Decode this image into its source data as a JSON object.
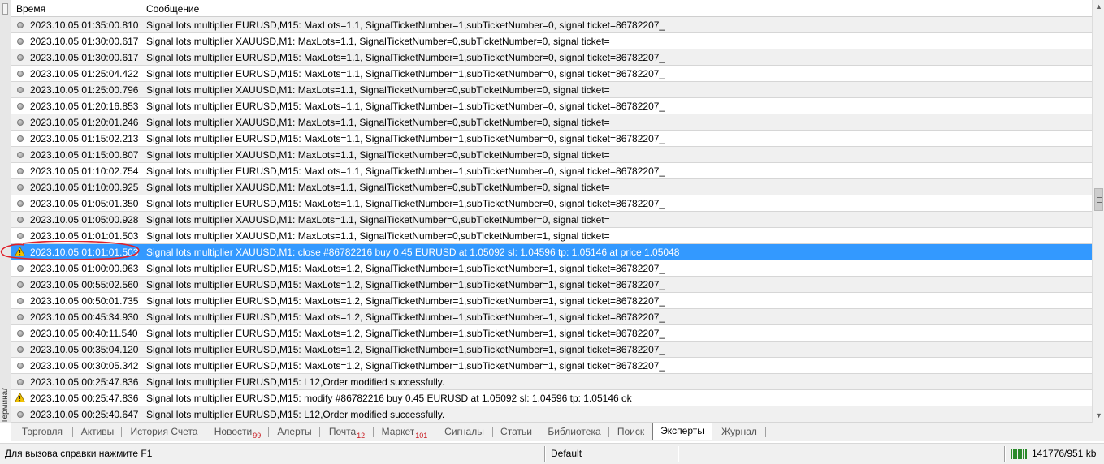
{
  "side_label": "Терминал",
  "columns": {
    "time": "Время",
    "message": "Сообщение"
  },
  "rows": [
    {
      "icon": "info",
      "time": "2023.10.05 01:35:00.810",
      "message": "Signal lots multiplier EURUSD,M15: MaxLots=1.1, SignalTicketNumber=1,subTicketNumber=0, signal ticket=86782207_"
    },
    {
      "icon": "info",
      "time": "2023.10.05 01:30:00.617",
      "message": "Signal lots multiplier XAUUSD,M1: MaxLots=1.1, SignalTicketNumber=0,subTicketNumber=0, signal ticket="
    },
    {
      "icon": "info",
      "time": "2023.10.05 01:30:00.617",
      "message": "Signal lots multiplier EURUSD,M15: MaxLots=1.1, SignalTicketNumber=1,subTicketNumber=0, signal ticket=86782207_"
    },
    {
      "icon": "info",
      "time": "2023.10.05 01:25:04.422",
      "message": "Signal lots multiplier EURUSD,M15: MaxLots=1.1, SignalTicketNumber=1,subTicketNumber=0, signal ticket=86782207_"
    },
    {
      "icon": "info",
      "time": "2023.10.05 01:25:00.796",
      "message": "Signal lots multiplier XAUUSD,M1: MaxLots=1.1, SignalTicketNumber=0,subTicketNumber=0, signal ticket="
    },
    {
      "icon": "info",
      "time": "2023.10.05 01:20:16.853",
      "message": "Signal lots multiplier EURUSD,M15: MaxLots=1.1, SignalTicketNumber=1,subTicketNumber=0, signal ticket=86782207_"
    },
    {
      "icon": "info",
      "time": "2023.10.05 01:20:01.246",
      "message": "Signal lots multiplier XAUUSD,M1: MaxLots=1.1, SignalTicketNumber=0,subTicketNumber=0, signal ticket="
    },
    {
      "icon": "info",
      "time": "2023.10.05 01:15:02.213",
      "message": "Signal lots multiplier EURUSD,M15: MaxLots=1.1, SignalTicketNumber=1,subTicketNumber=0, signal ticket=86782207_"
    },
    {
      "icon": "info",
      "time": "2023.10.05 01:15:00.807",
      "message": "Signal lots multiplier XAUUSD,M1: MaxLots=1.1, SignalTicketNumber=0,subTicketNumber=0, signal ticket="
    },
    {
      "icon": "info",
      "time": "2023.10.05 01:10:02.754",
      "message": "Signal lots multiplier EURUSD,M15: MaxLots=1.1, SignalTicketNumber=1,subTicketNumber=0, signal ticket=86782207_"
    },
    {
      "icon": "info",
      "time": "2023.10.05 01:10:00.925",
      "message": "Signal lots multiplier XAUUSD,M1: MaxLots=1.1, SignalTicketNumber=0,subTicketNumber=0, signal ticket="
    },
    {
      "icon": "info",
      "time": "2023.10.05 01:05:01.350",
      "message": "Signal lots multiplier EURUSD,M15: MaxLots=1.1, SignalTicketNumber=1,subTicketNumber=0, signal ticket=86782207_"
    },
    {
      "icon": "info",
      "time": "2023.10.05 01:05:00.928",
      "message": "Signal lots multiplier XAUUSD,M1: MaxLots=1.1, SignalTicketNumber=0,subTicketNumber=0, signal ticket="
    },
    {
      "icon": "info",
      "time": "2023.10.05 01:01:01.503",
      "message": "Signal lots multiplier XAUUSD,M1: MaxLots=1.1, SignalTicketNumber=0,subTicketNumber=1, signal ticket="
    },
    {
      "icon": "warning",
      "selected": true,
      "time": "2023.10.05 01:01:01.503",
      "message": "Signal lots multiplier XAUUSD,M1: close #86782216 buy 0.45 EURUSD at 1.05092 sl: 1.04596 tp: 1.05146 at price 1.05048"
    },
    {
      "icon": "info",
      "time": "2023.10.05 01:00:00.963",
      "message": "Signal lots multiplier EURUSD,M15: MaxLots=1.2, SignalTicketNumber=1,subTicketNumber=1, signal ticket=86782207_"
    },
    {
      "icon": "info",
      "time": "2023.10.05 00:55:02.560",
      "message": "Signal lots multiplier EURUSD,M15: MaxLots=1.2, SignalTicketNumber=1,subTicketNumber=1, signal ticket=86782207_"
    },
    {
      "icon": "info",
      "time": "2023.10.05 00:50:01.735",
      "message": "Signal lots multiplier EURUSD,M15: MaxLots=1.2, SignalTicketNumber=1,subTicketNumber=1, signal ticket=86782207_"
    },
    {
      "icon": "info",
      "time": "2023.10.05 00:45:34.930",
      "message": "Signal lots multiplier EURUSD,M15: MaxLots=1.2, SignalTicketNumber=1,subTicketNumber=1, signal ticket=86782207_"
    },
    {
      "icon": "info",
      "time": "2023.10.05 00:40:11.540",
      "message": "Signal lots multiplier EURUSD,M15: MaxLots=1.2, SignalTicketNumber=1,subTicketNumber=1, signal ticket=86782207_"
    },
    {
      "icon": "info",
      "time": "2023.10.05 00:35:04.120",
      "message": "Signal lots multiplier EURUSD,M15: MaxLots=1.2, SignalTicketNumber=1,subTicketNumber=1, signal ticket=86782207_"
    },
    {
      "icon": "info",
      "time": "2023.10.05 00:30:05.342",
      "message": "Signal lots multiplier EURUSD,M15: MaxLots=1.2, SignalTicketNumber=1,subTicketNumber=1, signal ticket=86782207_"
    },
    {
      "icon": "info",
      "time": "2023.10.05 00:25:47.836",
      "message": "Signal lots multiplier EURUSD,M15: L12,Order modified successfully."
    },
    {
      "icon": "warning",
      "time": "2023.10.05 00:25:47.836",
      "message": "Signal lots multiplier EURUSD,M15: modify #86782216 buy 0.45 EURUSD at 1.05092 sl: 1.04596 tp: 1.05146 ok"
    },
    {
      "icon": "info",
      "time": "2023.10.05 00:25:40.647",
      "message": "Signal lots multiplier EURUSD,M15: L12,Order modified successfully."
    }
  ],
  "tabs": [
    {
      "label": "Торговля"
    },
    {
      "label": "Активы"
    },
    {
      "label": "История Счета"
    },
    {
      "label": "Новости",
      "count": "99"
    },
    {
      "label": "Алерты"
    },
    {
      "label": "Почта",
      "count": "12"
    },
    {
      "label": "Маркет",
      "count": "101"
    },
    {
      "label": "Сигналы"
    },
    {
      "label": "Статьи"
    },
    {
      "label": "Библиотека"
    },
    {
      "label": "Поиск"
    },
    {
      "label": "Эксперты",
      "active": true
    },
    {
      "label": "Журнал"
    }
  ],
  "status": {
    "help": "Для вызова справки нажмите F1",
    "profile": "Default",
    "traffic": "141776/951 kb"
  },
  "colors": {
    "selection": "#3399ff",
    "annotation": "#e0202a",
    "warning": "#f2c200",
    "badge": "#c8161d"
  }
}
